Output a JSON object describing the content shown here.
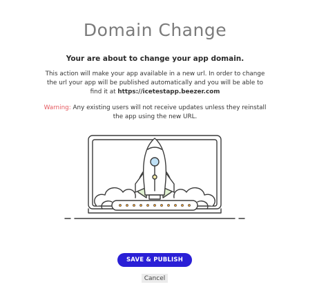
{
  "dialog": {
    "title": "Domain Change",
    "subtitle": "Your are about to change your app domain.",
    "description_text": "This action will make your app available in a new url. In order to change the url your app will be published automatically and you will be able to find it at ",
    "new_url": "https://icetestapp.beezer.com",
    "warning_label": "Warning:",
    "warning_text": " Any existing users will not receive updates unless they reinstall the app using the new URL."
  },
  "illustration": {
    "icon": "rocket-launch-laptop-icon",
    "colors": {
      "outline": "#3a3a3a",
      "flame_green": "#dff0d0",
      "window_blue": "#bfe0f5",
      "light_yellow": "#f3e9a8",
      "dots_orange": "#e09a3c"
    }
  },
  "actions": {
    "save_label": "SAVE & PUBLISH",
    "cancel_label": "Cancel"
  },
  "colors": {
    "primary_button": "#2a1fd6",
    "warning": "#e5595f",
    "title": "#7b7b7b"
  }
}
